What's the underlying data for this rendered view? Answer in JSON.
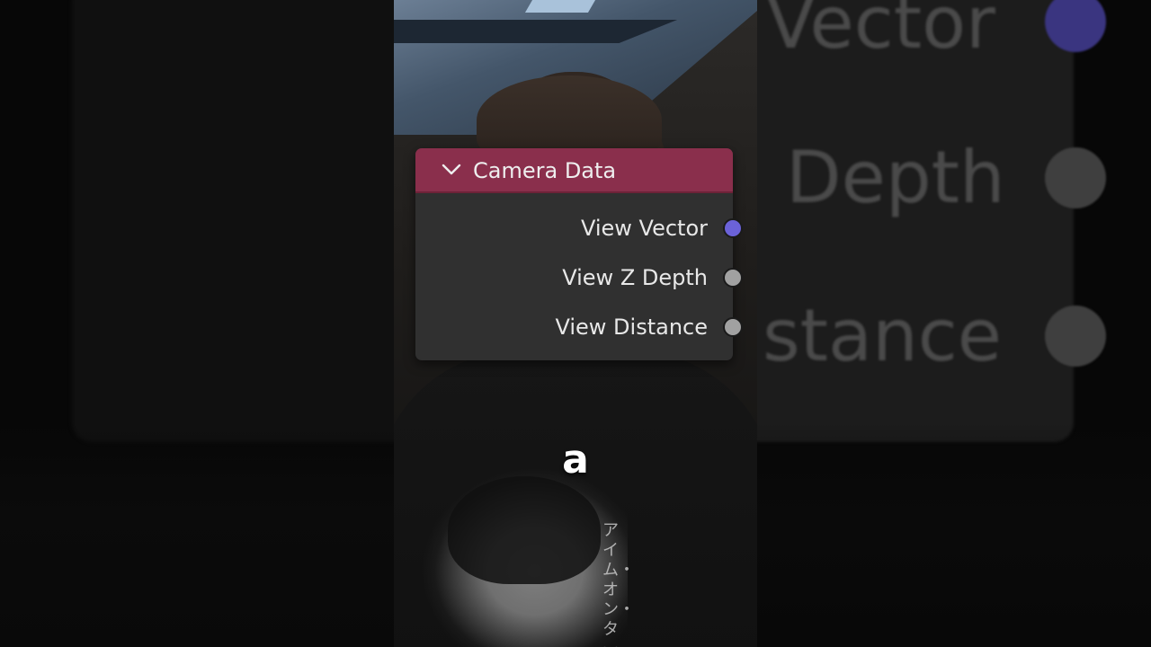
{
  "node": {
    "title": "Camera Data",
    "header_color": "#8a2f4c",
    "body_color": "#303030",
    "collapse_icon": "chevron-down-icon",
    "outputs": [
      {
        "label": "View Vector",
        "socket_color": "#6b62d8",
        "socket_type": "vector"
      },
      {
        "label": "View Z Depth",
        "socket_color": "#a1a1a1",
        "socket_type": "float"
      },
      {
        "label": "View Distance",
        "socket_color": "#a1a1a1",
        "socket_type": "float"
      }
    ]
  },
  "backdrop": {
    "ghost_labels": [
      "Vector",
      "Depth",
      "stance"
    ],
    "ghost_socket_colors": [
      "#3a3580",
      "#3f3f3f",
      "#3f3f3f"
    ]
  },
  "hoodie_print_text": "アイム・オン・ター",
  "caption": "a"
}
